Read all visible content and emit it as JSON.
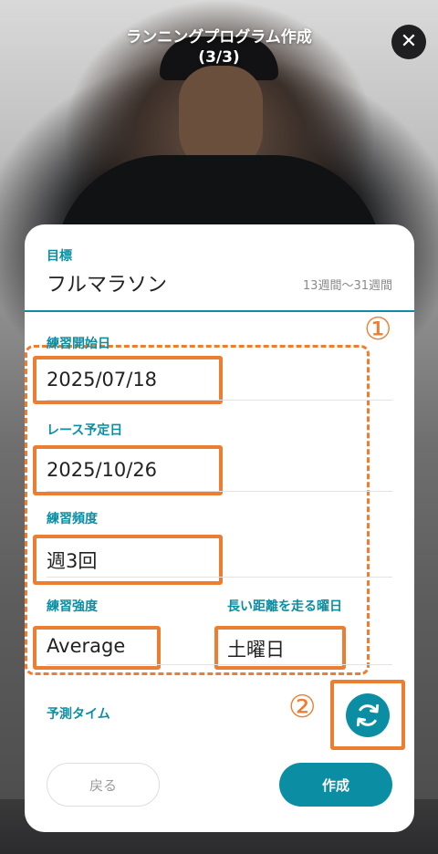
{
  "header": {
    "title_line1": "ランニングプログラム作成",
    "title_line2": "(3/3)",
    "close_symbol": "✕"
  },
  "goal": {
    "label": "目標",
    "value": "フルマラソン",
    "duration_hint": "13週間〜31週間"
  },
  "fields": {
    "start_date": {
      "label": "練習開始日",
      "value": "2025/07/18"
    },
    "race_date": {
      "label": "レース予定日",
      "value": "2025/10/26"
    },
    "frequency": {
      "label": "練習頻度",
      "value": "週3回"
    },
    "intensity": {
      "label": "練習強度",
      "value": "Average"
    },
    "long_run_day": {
      "label": "長い距離を走る曜日",
      "value": "土曜日"
    }
  },
  "predicted_time": {
    "label": "予測タイム"
  },
  "annotations": {
    "marker1": "①",
    "marker2": "②"
  },
  "buttons": {
    "back": "戻る",
    "create": "作成"
  },
  "icons": {
    "close": "close-icon",
    "refresh": "refresh-icon"
  },
  "colors": {
    "accent": "#0b8ea3",
    "highlight": "#ed7d31"
  }
}
